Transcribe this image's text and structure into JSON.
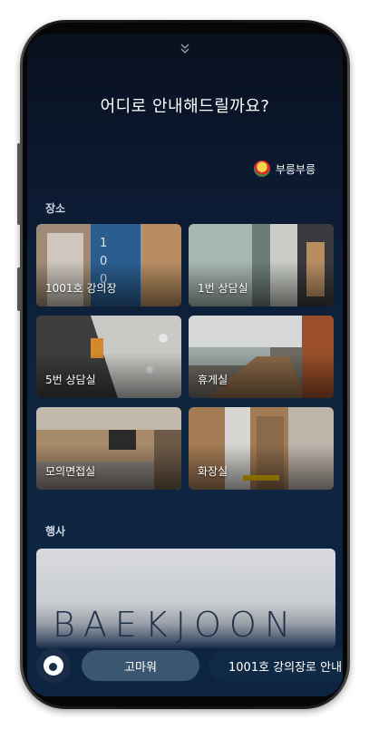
{
  "screen": {
    "title": "어디로 안내해드릴까요?",
    "handle_icon": "double-chevron-down-icon",
    "account": {
      "name": "부릉부릉",
      "avatar_icon": "car-avatar-icon"
    }
  },
  "places": {
    "section_label": "장소",
    "items": [
      {
        "label": "1001호 강의장"
      },
      {
        "label": "1번 상담실"
      },
      {
        "label": "5번 상담실"
      },
      {
        "label": "휴게실"
      },
      {
        "label": "모의면접실"
      },
      {
        "label": "화장실"
      }
    ]
  },
  "events": {
    "section_label": "행사",
    "banner_text": "BAEKJOON"
  },
  "bottom": {
    "assistant_icon": "bixby-icon",
    "chips": [
      {
        "label": "고마워"
      },
      {
        "label": "1001호 강의장로 안내"
      }
    ]
  },
  "colors": {
    "background_top": "#08101e",
    "background_bottom": "#0d2442",
    "chip_primary": "#3b5670",
    "chip_secondary": "#102a46"
  }
}
